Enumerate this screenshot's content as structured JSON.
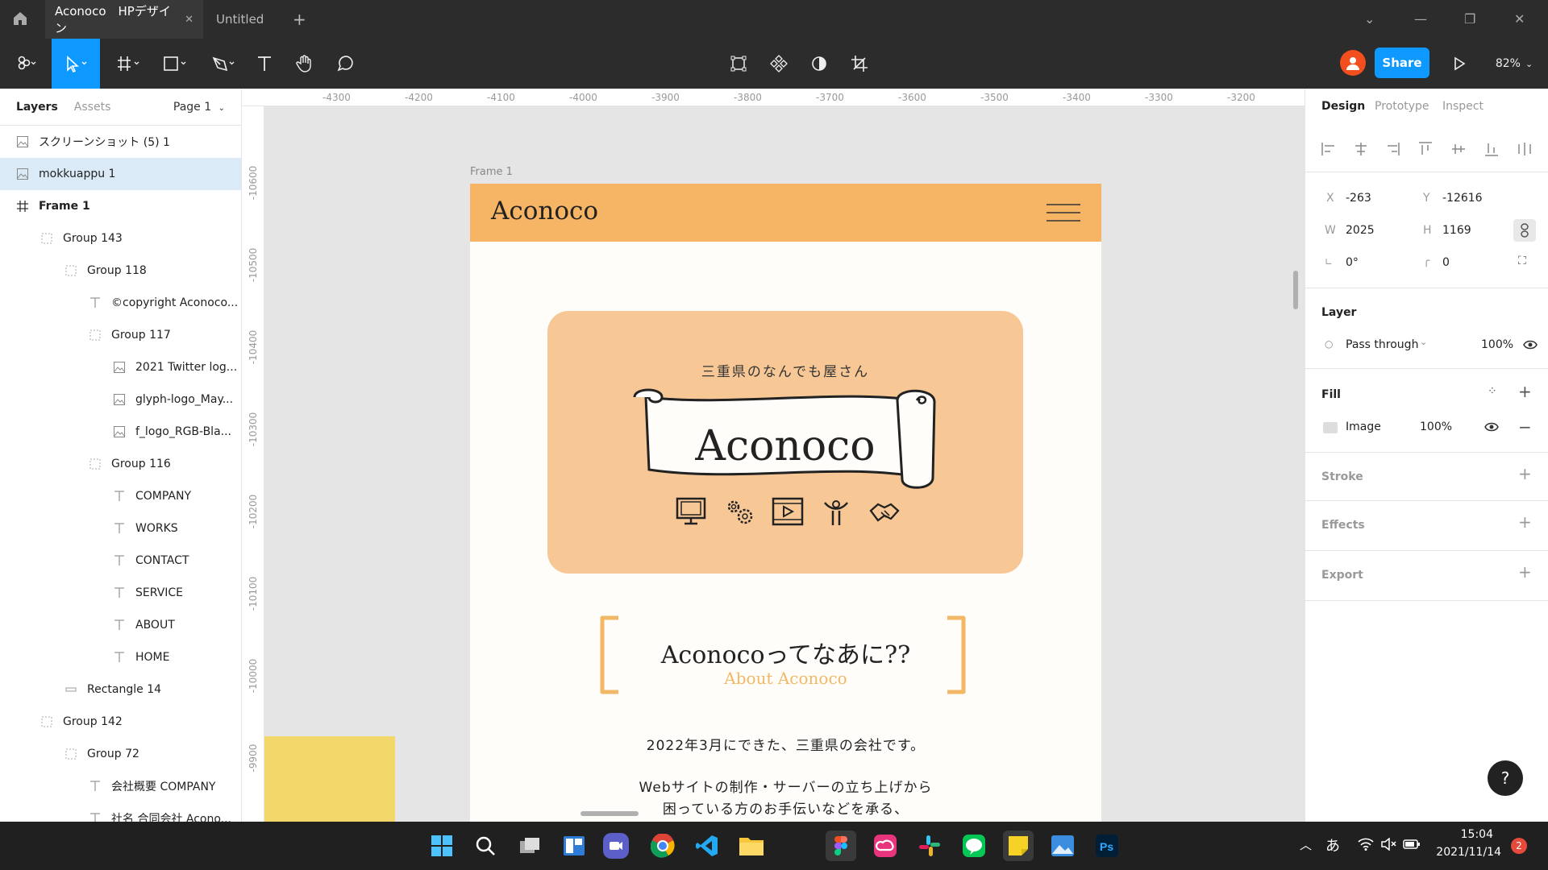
{
  "titlebar": {
    "active_tab": "Aconoco　HPデザイン",
    "tab2": "Untitled"
  },
  "toolbar": {
    "zoom": "82%",
    "share": "Share"
  },
  "left_panel": {
    "tabs": [
      "Layers",
      "Assets"
    ],
    "page": "Page 1",
    "layers": [
      {
        "label": "スクリーンショット (5) 1",
        "icon": "image-icon"
      },
      {
        "label": "mokkuappu 1",
        "icon": "image-icon"
      },
      {
        "label": "Frame 1",
        "icon": "frame-icon"
      },
      {
        "label": "Group 143",
        "icon": "group-icon"
      },
      {
        "label": "Group 118",
        "icon": "group-icon"
      },
      {
        "label": "©copyright Aconoco...",
        "icon": "text-icon"
      },
      {
        "label": "Group 117",
        "icon": "group-icon"
      },
      {
        "label": "2021 Twitter log...",
        "icon": "image-icon"
      },
      {
        "label": "glyph-logo_May...",
        "icon": "image-icon"
      },
      {
        "label": "f_logo_RGB-Bla...",
        "icon": "image-icon"
      },
      {
        "label": "Group 116",
        "icon": "group-icon"
      },
      {
        "label": "COMPANY",
        "icon": "text-icon"
      },
      {
        "label": "WORKS",
        "icon": "text-icon"
      },
      {
        "label": "CONTACT",
        "icon": "text-icon"
      },
      {
        "label": "SERVICE",
        "icon": "text-icon"
      },
      {
        "label": "ABOUT",
        "icon": "text-icon"
      },
      {
        "label": "HOME",
        "icon": "text-icon"
      },
      {
        "label": "Rectangle 14",
        "icon": "rectangle-icon"
      },
      {
        "label": "Group 142",
        "icon": "group-icon"
      },
      {
        "label": "Group 72",
        "icon": "group-icon"
      },
      {
        "label": "会社概要 COMPANY",
        "icon": "text-icon"
      },
      {
        "label": "社名 合同会社 Acono...",
        "icon": "text-icon"
      }
    ]
  },
  "rulers": {
    "top": [
      "-4300",
      "-4200",
      "-4100",
      "-4000",
      "-3900",
      "-3800",
      "-3700",
      "-3600",
      "-3500",
      "-3400",
      "-3300",
      "-3200"
    ],
    "left": [
      "-10600",
      "-10500",
      "-10400",
      "-10300",
      "-10200",
      "-10100",
      "-10000",
      "-9900"
    ]
  },
  "canvas": {
    "frame_label": "Frame 1",
    "site_logo": "Aconoco",
    "hero_tagline": "三重県のなんでも屋さん",
    "hero_title": "Aconoco",
    "about_title": "Aconocoってなあに??",
    "about_subtitle": "About Aconoco",
    "body_line1": "2022年3月にできた、三重県の会社です。",
    "body_line2": "Webサイトの制作・サーバーの立ち上げから",
    "body_line3": "困っている方のお手伝いなどを承る、",
    "colors": {
      "header": "#f6b465",
      "hero": "#f7c896",
      "accent": "#f2b866",
      "canvas": "#e5e5e5"
    }
  },
  "right_panel": {
    "tabs": [
      "Design",
      "Prototype",
      "Inspect"
    ],
    "x_label": "X",
    "x": "-263",
    "y_label": "Y",
    "y": "-12616",
    "w_label": "W",
    "w": "2025",
    "h_label": "H",
    "h": "1169",
    "rotation": "0°",
    "radius": "0",
    "layer_title": "Layer",
    "blend": "Pass through",
    "layer_opacity": "100%",
    "fill_title": "Fill",
    "fill_type": "Image",
    "fill_opacity": "100%",
    "stroke_title": "Stroke",
    "effects_title": "Effects",
    "export_title": "Export",
    "help": "?"
  },
  "taskbar": {
    "time": "15:04",
    "date": "2021/11/14",
    "ime": "あ",
    "notif_count": "2",
    "apps": [
      "start",
      "search",
      "task-view",
      "widgets",
      "teams",
      "chrome",
      "vscode",
      "explorer",
      "figma",
      "creative-cloud",
      "slack",
      "line",
      "sticky-notes",
      "photos",
      "photoshop"
    ]
  }
}
